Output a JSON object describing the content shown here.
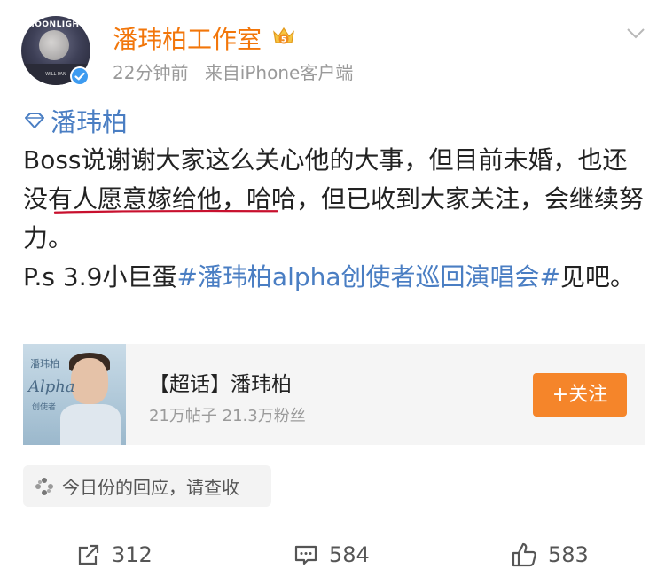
{
  "author": {
    "name": "潘玮柏工作室",
    "avatar_text": "MOONLIGHT",
    "avatar_small_text": "WILL PAN",
    "verified_icon": "verified-badge-icon",
    "member_icon": "crown-vip-icon",
    "member_level": "5"
  },
  "post": {
    "time": "22分钟前",
    "source": "来自iPhone客户端",
    "topic": "潘玮柏",
    "body_part1": "Boss说谢谢大家这么关心他的大事，但目前未婚，也还没有人愿意嫁给他，哈哈，但已收到大家关注，会继续努力。",
    "body_part2": "P.s  3.9小巨蛋",
    "hashtag": "#潘玮柏alpha创使者巡回演唱会#",
    "body_part3": "见吧。"
  },
  "supertopic_card": {
    "title": "【超话】潘玮柏",
    "stats": "21万帖子 21.3万粉丝",
    "follow_label": "+关注",
    "image_text_1": "潘玮柏",
    "image_text_2": "Alpha",
    "image_text_3": "创使者",
    "accent_color": "#f5852a"
  },
  "recall": {
    "label": "今日份的回应，请查收"
  },
  "actions": {
    "repost_count": "312",
    "comment_count": "584",
    "like_count": "583"
  },
  "colors": {
    "name_orange": "#f2760a",
    "link_blue": "#4a7ec3",
    "underline_red": "#c8102e"
  }
}
